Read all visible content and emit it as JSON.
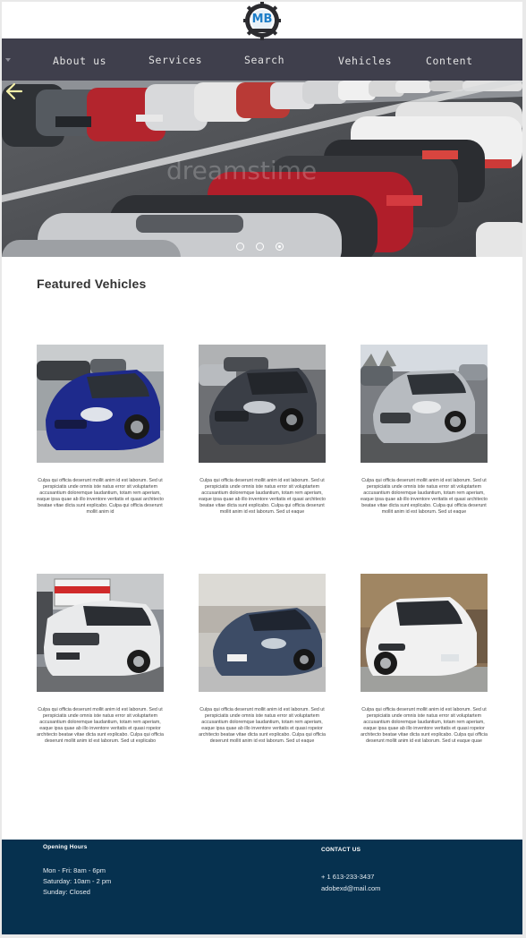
{
  "brand": {
    "logo_text": "MB"
  },
  "nav": {
    "items": [
      {
        "label": "About us"
      },
      {
        "label": "Services"
      },
      {
        "label": "Search"
      },
      {
        "label": "Vehicles"
      },
      {
        "label": "Content"
      }
    ]
  },
  "hero": {
    "watermark": "dreamstime",
    "slides": {
      "count": 3,
      "active_index": 2
    }
  },
  "featured": {
    "title": "Featured Vehicles",
    "cards": [
      {
        "desc": "Culpa qui officia deserunt mollit anim id est laborum. Sed ut perspiciatis unde omnis iste natus error sit voluptartem accusantium doloremque laudantium, totam rem aperiam, eaque ipsa quae ab illo inventore veritatis et quasi architecto beatae vitae dicta sunt explicabo. Culpa qui officia deserunt mollit anim id"
      },
      {
        "desc": "Culpa qui officia deserunt mollit anim id est laborum. Sed ut perspiciatis unde omnis iste natus error sit voluptartem accusantium doloremque laudantium, totam rem aperiam, eaque ipsa quae ab illo inventore veritatis et quasi architecto beatae vitae dicta sunt explicabo. Culpa qui officia deserunt mollit anim id est laborum. Sed ut eaque"
      },
      {
        "desc": "Culpa qui officia deserunt mollit anim id est laborum. Sed ut perspiciatis unde omnis iste natus error sit voluptartem accusantium doloremque laudantium, totam rem aperiam, eaque ipsa quae ab illo inventore veritatis et quasi architecto beatae vitae dicta sunt explicabo. Culpa qui officia deserunt mollit anim id est laborum. Sed ut eaque"
      },
      {
        "desc": "Culpa qui officia deserunt mollit anim id est laborum. Sed ut perspiciatis unde omnis iste natus error sit voluptartem accusantium doloremque laudantium, totam rem aperiam, eaque ipsa quae ab illo inventore veritatis et quasi ropeior architecto beatae vitae dicta sunt explicabo. Culpa qui officia deserunt mollit anim id est laborum. Sed ut explicabo"
      },
      {
        "desc": "Culpa qui officia deserunt mollit anim id est laborum. Sed ut perspiciatis unde omnis iste natus error sit voluptartem accusantium doloremque laudantium, totam rem aperiam, eaque ipsa quae ab illo inventore veritatis et quasi ropeior architecto beatae vitae dicta sunt explicabo. Culpa qui officia deserunt mollit anim id est laborum. Sed ut eaque"
      },
      {
        "desc": "Culpa qui officia deserunt mollit anim id est laborum. Sed ut perspiciatis unde omnis iste natus error sit voluptartem accusantium doloremque laudantium, totam rem aperiam, eaque ipsa quae ab illo inventore veritatis et quasi ropeior architecto beatae vitae dicta sunt explicabo. Culpa qui officia deserunt mollit anim id est laborum. Sed ut eaque quae"
      }
    ]
  },
  "footer": {
    "hours_title": "Opening Hours",
    "hours": [
      "Mon - Fri: 8am - 6pm",
      "Saturday: 10am - 2 pm",
      "Sunday: Closed"
    ],
    "contact_title": "CONTACT US",
    "phone": "+ 1 613-233-3437",
    "email": "adobexd@mail.com"
  },
  "colors": {
    "navbar": "#3f3f4c",
    "footer": "#06314f",
    "logo_blue": "#1e7ec8"
  }
}
